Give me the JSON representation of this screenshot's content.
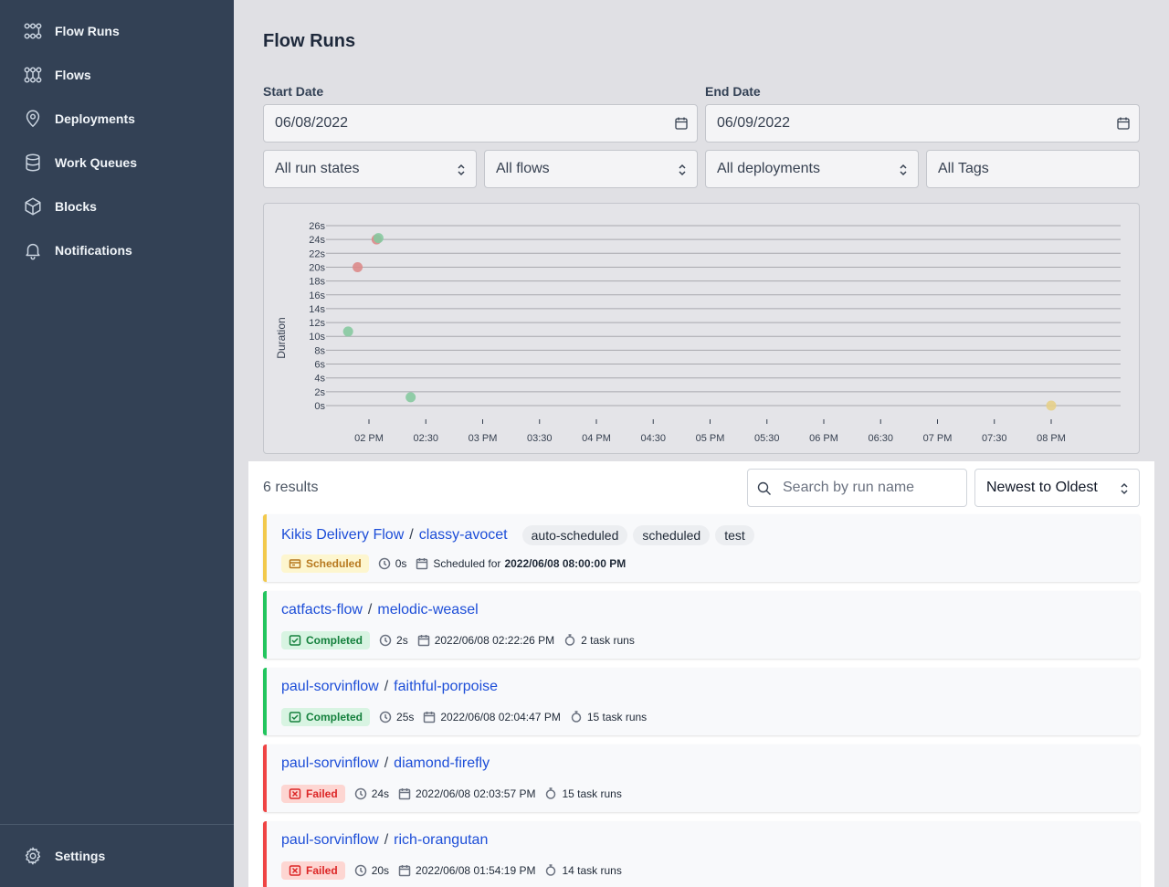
{
  "sidebar": {
    "items": [
      {
        "label": "Flow Runs",
        "icon": "flow-runs-icon"
      },
      {
        "label": "Flows",
        "icon": "flows-icon"
      },
      {
        "label": "Deployments",
        "icon": "location-pin-icon"
      },
      {
        "label": "Work Queues",
        "icon": "database-icon"
      },
      {
        "label": "Blocks",
        "icon": "cube-icon"
      },
      {
        "label": "Notifications",
        "icon": "bell-icon"
      }
    ],
    "settings": {
      "label": "Settings",
      "icon": "gear-icon"
    }
  },
  "page": {
    "title": "Flow Runs"
  },
  "filters": {
    "start_date_label": "Start Date",
    "start_date": "06/08/2022",
    "end_date_label": "End Date",
    "end_date": "06/09/2022",
    "run_states": "All run states",
    "flows": "All flows",
    "deployments": "All deployments",
    "tags": "All Tags"
  },
  "chart_data": {
    "type": "scatter",
    "ylabel": "Duration",
    "xlabel": "",
    "y_ticks": [
      "0s",
      "2s",
      "4s",
      "6s",
      "8s",
      "10s",
      "12s",
      "14s",
      "16s",
      "18s",
      "20s",
      "22s",
      "24s",
      "26s"
    ],
    "ylim": [
      0,
      26
    ],
    "x_ticks": [
      "02 PM",
      "02:30",
      "03 PM",
      "03:30",
      "04 PM",
      "04:30",
      "05 PM",
      "05:30",
      "06 PM",
      "06:30",
      "07 PM",
      "07:30",
      "08 PM"
    ],
    "grid": true,
    "colors": {
      "Completed": "#86c9a0",
      "Failed": "#dc8a8a",
      "Scheduled": "#e6cf8a"
    },
    "points": [
      {
        "time": "01:54",
        "duration": 20,
        "state": "Failed"
      },
      {
        "time": "01:49",
        "duration": 10.7,
        "state": "Completed"
      },
      {
        "time": "02:04",
        "duration": 24,
        "state": "Failed"
      },
      {
        "time": "02:05",
        "duration": 24.2,
        "state": "Completed"
      },
      {
        "time": "02:22",
        "duration": 1.2,
        "state": "Completed"
      },
      {
        "time": "08:00",
        "duration": 0,
        "state": "Scheduled"
      }
    ]
  },
  "results": {
    "count_text": "6 results",
    "search_placeholder": "Search by run name",
    "sort_value": "Newest to Oldest",
    "runs": [
      {
        "flow": "Kikis Delivery Flow",
        "name": "classy-avocet",
        "state": "Scheduled",
        "duration": "0s",
        "date_prefix": "Scheduled for",
        "date": "2022/06/08 08:00:00 PM",
        "task_runs": "",
        "tags": [
          "auto-scheduled",
          "scheduled",
          "test"
        ],
        "color": "#f2c94c"
      },
      {
        "flow": "catfacts-flow",
        "name": "melodic-weasel",
        "state": "Completed",
        "duration": "2s",
        "date_prefix": "",
        "date": "2022/06/08 02:22:26 PM",
        "task_runs": "2 task runs",
        "tags": [],
        "color": "#22c55e"
      },
      {
        "flow": "paul-sorvinflow",
        "name": "faithful-porpoise",
        "state": "Completed",
        "duration": "25s",
        "date_prefix": "",
        "date": "2022/06/08 02:04:47 PM",
        "task_runs": "15 task runs",
        "tags": [],
        "color": "#22c55e"
      },
      {
        "flow": "paul-sorvinflow",
        "name": "diamond-firefly",
        "state": "Failed",
        "duration": "24s",
        "date_prefix": "",
        "date": "2022/06/08 02:03:57 PM",
        "task_runs": "15 task runs",
        "tags": [],
        "color": "#ef4444"
      },
      {
        "flow": "paul-sorvinflow",
        "name": "rich-orangutan",
        "state": "Failed",
        "duration": "20s",
        "date_prefix": "",
        "date": "2022/06/08 01:54:19 PM",
        "task_runs": "14 task runs",
        "tags": [],
        "color": "#ef4444"
      }
    ]
  }
}
